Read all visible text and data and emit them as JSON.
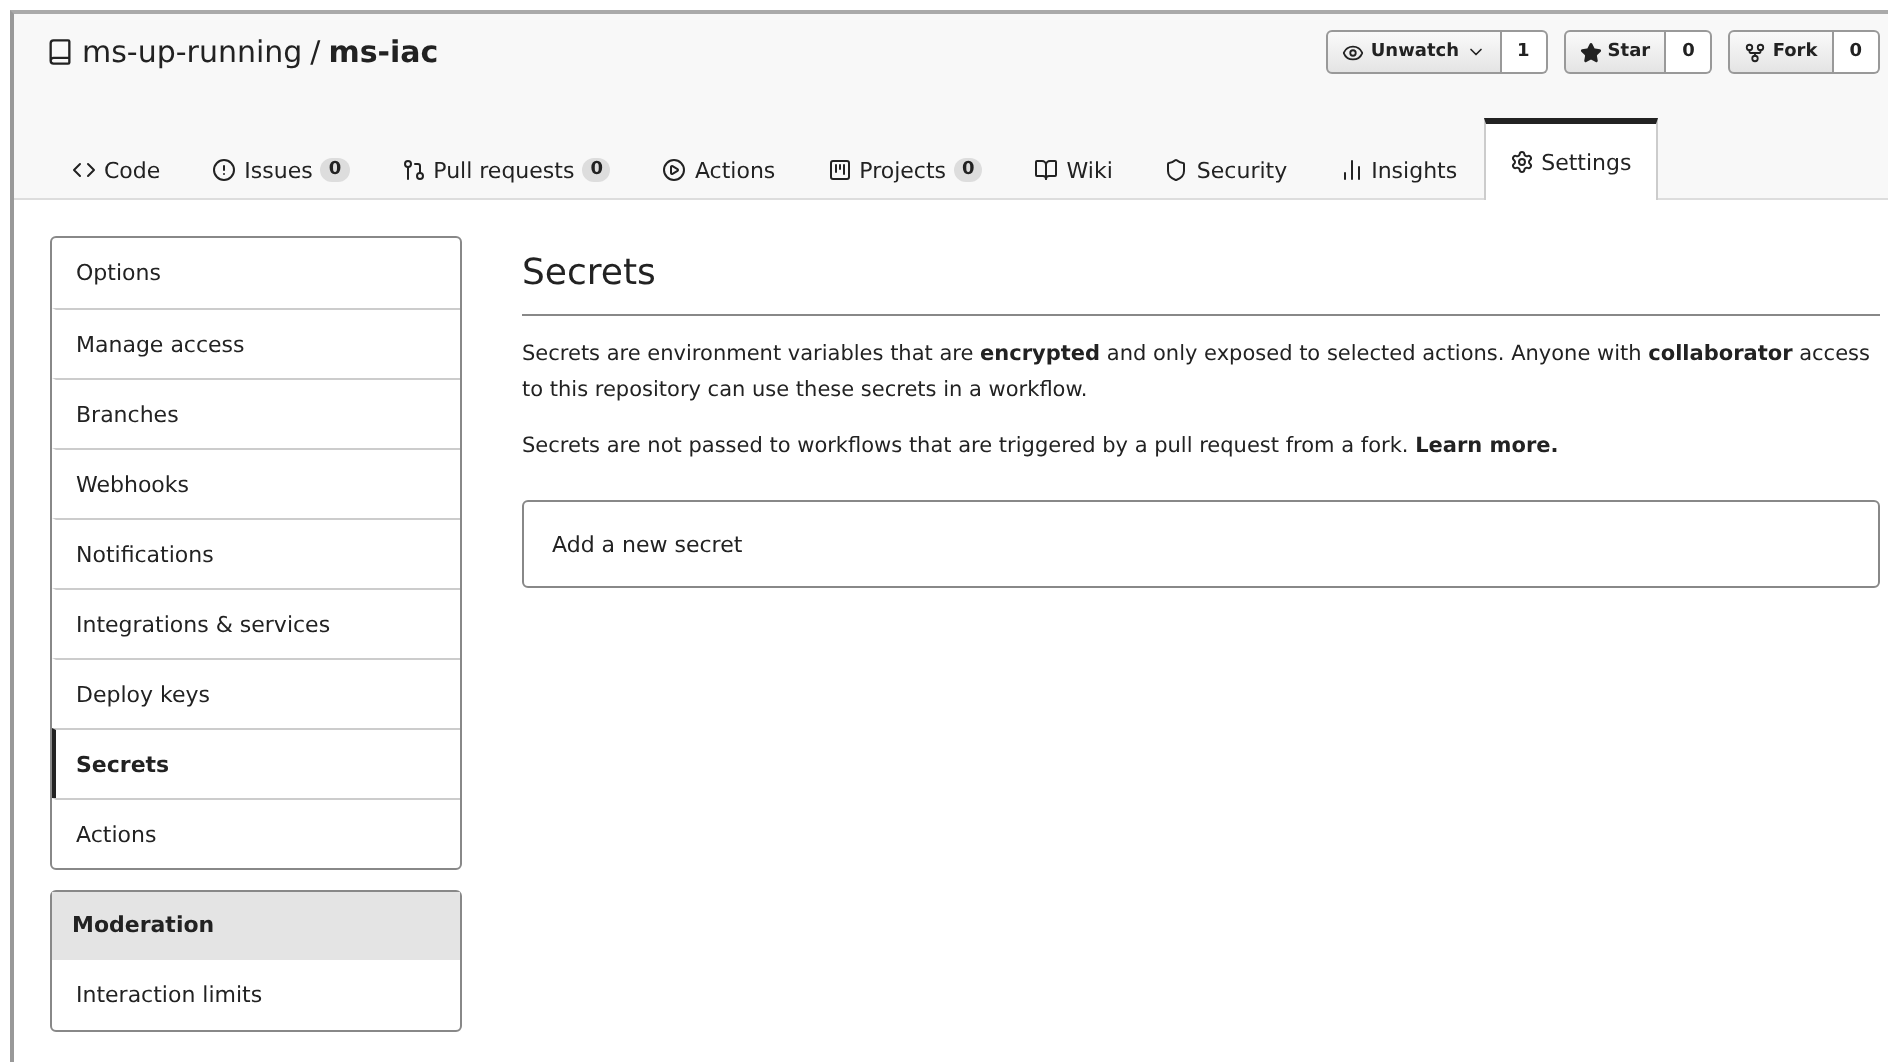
{
  "repo": {
    "owner": "ms-up-running",
    "separator": "/",
    "name": "ms-iac"
  },
  "actions": [
    {
      "kind": "watch",
      "label": "Unwatch",
      "count": "1"
    },
    {
      "kind": "star",
      "label": "Star",
      "count": "0"
    },
    {
      "kind": "fork",
      "label": "Fork",
      "count": "0"
    }
  ],
  "tabs": [
    {
      "kind": "code",
      "label": "Code",
      "selected": false
    },
    {
      "kind": "issues",
      "label": "Issues",
      "counter": "0",
      "selected": false
    },
    {
      "kind": "pulls",
      "label": "Pull requests",
      "counter": "0",
      "selected": false
    },
    {
      "kind": "actions",
      "label": "Actions",
      "selected": false
    },
    {
      "kind": "projects",
      "label": "Projects",
      "counter": "0",
      "selected": false
    },
    {
      "kind": "wiki",
      "label": "Wiki",
      "selected": false
    },
    {
      "kind": "security",
      "label": "Security",
      "selected": false
    },
    {
      "kind": "insights",
      "label": "Insights",
      "selected": false
    },
    {
      "kind": "settings",
      "label": "Settings",
      "selected": true
    }
  ],
  "menus": [
    {
      "items": [
        {
          "label": "Options",
          "selected": false
        },
        {
          "label": "Manage access",
          "selected": false
        },
        {
          "label": "Branches",
          "selected": false
        },
        {
          "label": "Webhooks",
          "selected": false
        },
        {
          "label": "Notifications",
          "selected": false
        },
        {
          "label": "Integrations & services",
          "selected": false
        },
        {
          "label": "Deploy keys",
          "selected": false
        },
        {
          "label": "Secrets",
          "selected": true
        },
        {
          "label": "Actions",
          "selected": false
        }
      ]
    },
    {
      "heading": "Moderation",
      "items": [
        {
          "label": "Interaction limits",
          "selected": false
        }
      ]
    }
  ],
  "main": {
    "title": "Secrets",
    "paragraphs": [
      "Secrets are environment variables that are **encrypted** and only exposed to selected actions. Anyone with **collaborator** access to this repository can use these secrets in a workflow.",
      "Secrets are not passed to workflows that are triggered by a pull request from a fork."
    ],
    "link": "Learn more.",
    "add_button": "Add a new secret"
  }
}
